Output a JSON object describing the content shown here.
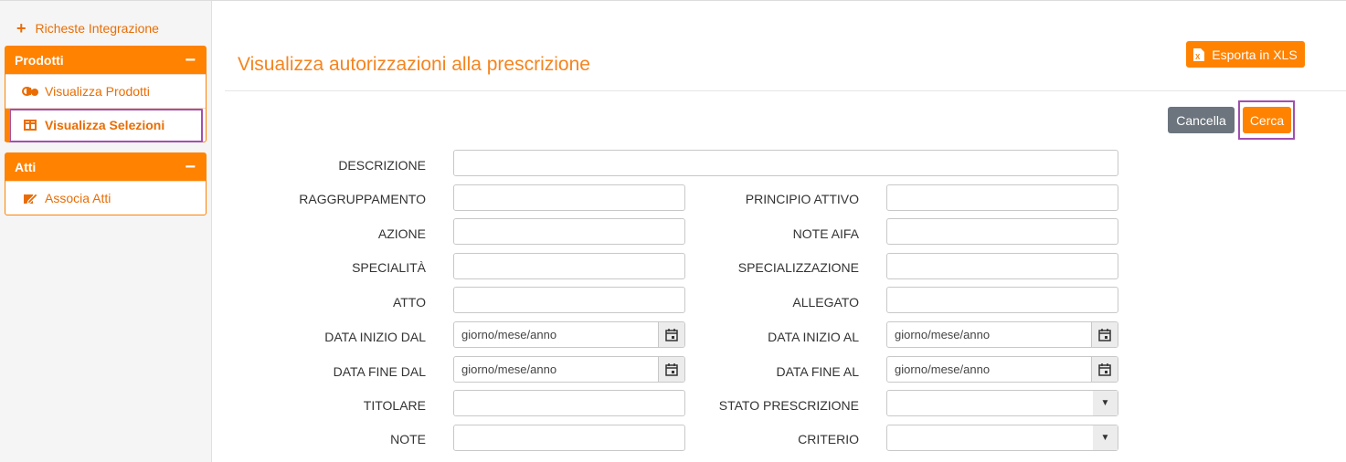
{
  "sidebar": {
    "top_link": "Richeste Integrazione",
    "panels": [
      {
        "title": "Prodotti",
        "items": [
          {
            "label": "Visualizza Prodotti",
            "icon": "pills-icon"
          },
          {
            "label": "Visualizza Selezioni",
            "icon": "table-columns-icon",
            "active": true
          }
        ]
      },
      {
        "title": "Atti",
        "items": [
          {
            "label": "Associa Atti",
            "icon": "edit-document-icon"
          }
        ]
      }
    ]
  },
  "page": {
    "title": "Visualizza autorizzazioni alla prescrizione",
    "export_label": "Esporta in XLS",
    "cancel_label": "Cancella",
    "search_label": "Cerca"
  },
  "form": {
    "descrizione": "DESCRIZIONE",
    "raggruppamento": "RAGGRUPPAMENTO",
    "principio_attivo": "PRINCIPIO ATTIVO",
    "azione": "AZIONE",
    "note_aifa": "NOTE AIFA",
    "specialita": "SPECIALITÀ",
    "specializzazione": "SPECIALIZZAZIONE",
    "atto": "ATTO",
    "allegato": "ALLEGATO",
    "data_inizio_dal": "DATA INIZIO DAL",
    "data_inizio_al": "DATA INIZIO AL",
    "data_fine_dal": "DATA FINE DAL",
    "data_fine_al": "DATA FINE AL",
    "titolare": "TITOLARE",
    "stato_prescrizione": "STATO PRESCRIZIONE",
    "note": "NOTE",
    "criterio": "CRITERIO",
    "date_placeholder": "giorno/mese/anno"
  },
  "colors": {
    "accent": "#ff8200",
    "title": "#f5841f",
    "highlight": "#a24fb0",
    "secondary": "#6c757d"
  }
}
